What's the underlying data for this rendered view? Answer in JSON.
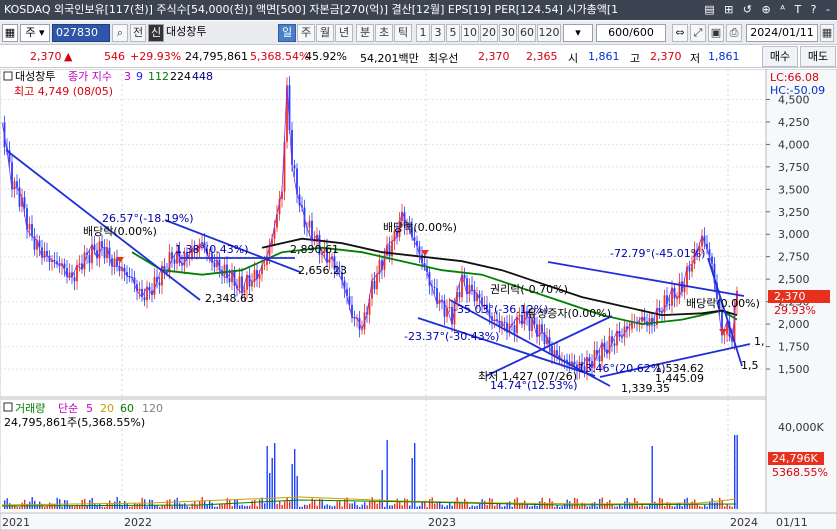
{
  "titlebar": {
    "text": "KOSDAQ 외국인보유[117(천)] 주식수[54,000(천)] 액면[500] 자본금[270(억)] 결산[12월] EPS[19] PER[124.54] 시가총액[1",
    "icons": "▤ ⊞ ↺ ⊕ ᴬ T ? -"
  },
  "toolbar": {
    "market": "주",
    "code": "027830",
    "jeon": "전",
    "sin": "신",
    "name": "대성창투",
    "periods": [
      "일",
      "주",
      "월",
      "년",
      "분",
      "초",
      "틱"
    ],
    "active_period": "일",
    "intervals": [
      "1",
      "3",
      "5",
      "10",
      "20",
      "30",
      "60",
      "120"
    ],
    "count": "600/600",
    "date": "2024/01/11",
    "buy": "매수",
    "sell": "매도"
  },
  "quote": {
    "price": "2,370",
    "change": "546",
    "change_pct": "+29.93%",
    "volume": "24,795,861",
    "volume_pct": "5,368.54%",
    "turnover": "45.92%",
    "amount": "54,201백만",
    "best_label": "최우선",
    "ask": "2,370",
    "bid": "2,365",
    "open_label": "시",
    "open": "1,861",
    "high_label": "고",
    "high": "2,370",
    "low_label": "저",
    "low": "1,861"
  },
  "chart": {
    "stock_label": "대성창투",
    "ma_label": "종가 지수",
    "ma_periods": [
      "3",
      "9",
      "112",
      "224",
      "448"
    ],
    "ma_colors": [
      "#c000c0",
      "#2020ff",
      "#008000",
      "#000000",
      "#000080"
    ],
    "lc_label": "LC:66.08",
    "hc_label": "HC:-50.09",
    "max_label": "최고 4,749 (08/05)",
    "y_ticks": [
      "4,500",
      "4,250",
      "4,000",
      "3,750",
      "3,500",
      "3,250",
      "3,000",
      "2,750",
      "2,500",
      "2,250",
      "2,000",
      "1,750",
      "1,500"
    ],
    "price_tag": "2,370",
    "price_tag_pct": "29.93%",
    "annotations": [
      "26.57°(-18.19%)",
      "배당락(0.00%)",
      "1.38°(0.43%)",
      "2,890.61",
      "2,656.23",
      "2,348.63",
      "배당락(0.00%)",
      "-72.79°(-45.01%)",
      "권리락(-0.70%)",
      "-35.03°(-36.12%)",
      "유상증자(0.00%)",
      "배당락(0.00%)",
      "-23.37°(-30.43%)",
      "13.46°(20.62%)",
      "1,534.62",
      "1,445.09",
      "최저 1,427 (07/26)",
      "14.74°(12.53%)",
      "1,339.35",
      "1,",
      "1,5"
    ]
  },
  "volume": {
    "label": "거래량",
    "ma_label": "단순",
    "ma_periods": [
      "5",
      "20",
      "60",
      "120"
    ],
    "ma_colors": [
      "#c000c0",
      "#c8a000",
      "#008000",
      "#808080"
    ],
    "value_text": "24,795,861주(5,368.55%)",
    "y_tick": "40,000K",
    "tag": "24,796K",
    "tag_pct": "5368.55%"
  },
  "x_axis": [
    "2021",
    "2022",
    "2023",
    "2024",
    "01/11"
  ],
  "chart_data": {
    "type": "line",
    "ylim": [
      1200,
      4750
    ],
    "series": [
      {
        "name": "종가",
        "x": [
          0,
          10,
          20,
          30,
          40,
          50,
          60,
          70,
          80,
          90,
          100,
          110,
          120,
          130,
          140,
          150,
          160,
          170,
          180,
          190,
          200,
          210,
          220,
          230,
          240,
          250,
          260,
          270,
          280,
          285,
          290,
          295,
          300,
          310,
          320,
          330,
          340,
          350,
          360,
          370,
          380,
          390,
          400,
          410,
          420,
          430,
          440,
          450,
          460,
          470,
          480,
          490,
          500,
          510,
          520,
          530,
          540,
          550,
          560,
          570,
          580,
          590,
          600,
          610,
          620,
          630,
          640,
          650,
          660,
          670,
          680,
          690,
          700,
          705,
          710,
          715,
          720,
          725,
          730,
          735
        ],
        "values": [
          4200,
          3600,
          3350,
          2950,
          2800,
          2700,
          2650,
          2500,
          2700,
          2800,
          2850,
          2700,
          2600,
          2500,
          2300,
          2400,
          2550,
          2750,
          2700,
          2800,
          2900,
          2700,
          2600,
          2500,
          2400,
          2500,
          2600,
          2950,
          3500,
          4600,
          3800,
          3500,
          3200,
          3000,
          2800,
          2700,
          2500,
          2100,
          1950,
          2400,
          2700,
          2900,
          3200,
          3000,
          2700,
          2400,
          2200,
          2100,
          2500,
          2350,
          2250,
          2050,
          2000,
          1950,
          2100,
          2000,
          1900,
          1700,
          1600,
          1550,
          1520,
          1600,
          1700,
          1800,
          1900,
          2000,
          2050,
          2000,
          2200,
          2300,
          2400,
          2700,
          2950,
          2850,
          2650,
          2300,
          1900,
          1950,
          1850,
          2370
        ]
      },
      {
        "name": "112",
        "x": [
          130,
          160,
          200,
          240,
          280,
          320,
          360,
          400,
          440,
          480,
          520,
          560,
          600,
          640,
          680,
          700,
          720,
          735
        ],
        "values": [
          2800,
          2600,
          2550,
          2600,
          2800,
          2850,
          2800,
          2700,
          2600,
          2550,
          2400,
          2250,
          2100,
          2000,
          2050,
          2100,
          2150,
          2050
        ]
      },
      {
        "name": "224",
        "x": [
          260,
          300,
          340,
          380,
          420,
          460,
          500,
          540,
          580,
          620,
          660,
          700,
          720,
          735
        ],
        "values": [
          2850,
          2950,
          2900,
          2800,
          2750,
          2700,
          2600,
          2450,
          2300,
          2200,
          2100,
          2120,
          2150,
          2100
        ]
      }
    ],
    "volume_tag": 24796
  }
}
